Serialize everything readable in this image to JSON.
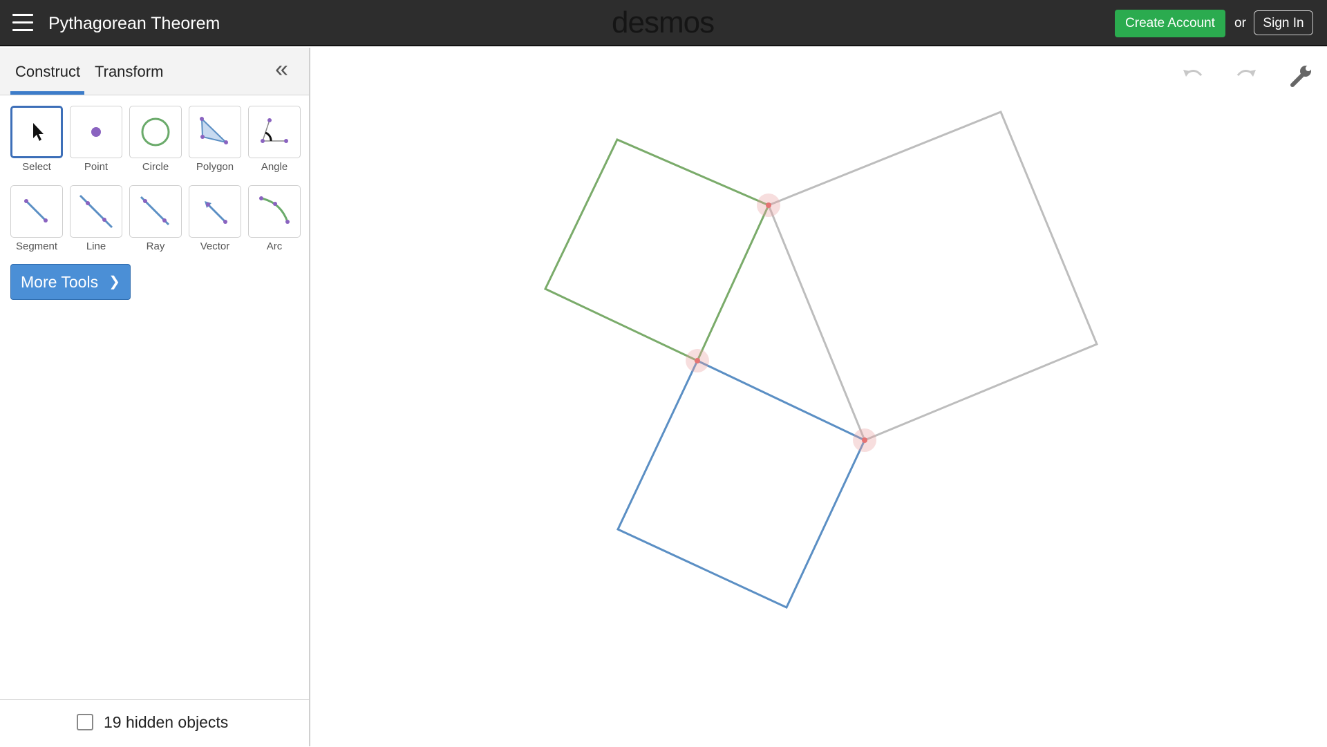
{
  "header": {
    "title": "Pythagorean Theorem",
    "brand": "desmos",
    "create_account": "Create Account",
    "or_text": "or",
    "sign_in": "Sign In"
  },
  "panel": {
    "tabs": [
      {
        "label": "Construct",
        "active": true
      },
      {
        "label": "Transform",
        "active": false
      }
    ],
    "tools": [
      {
        "label": "Select",
        "icon": "pointer-icon",
        "active": true
      },
      {
        "label": "Point",
        "icon": "point-icon"
      },
      {
        "label": "Circle",
        "icon": "circle-icon"
      },
      {
        "label": "Polygon",
        "icon": "polygon-icon"
      },
      {
        "label": "Angle",
        "icon": "angle-icon"
      },
      {
        "label": "Segment",
        "icon": "segment-icon"
      },
      {
        "label": "Line",
        "icon": "line-icon"
      },
      {
        "label": "Ray",
        "icon": "ray-icon"
      },
      {
        "label": "Vector",
        "icon": "vector-icon"
      },
      {
        "label": "Arc",
        "icon": "arc-icon"
      }
    ],
    "more_tools": "More Tools",
    "hidden_objects": "19 hidden objects"
  },
  "colors": {
    "square_a": "#7aab6a",
    "square_b": "#5b8fc4",
    "square_c": "#bdbdbd",
    "vertex": "#e8a0a0",
    "accent": "#3d7cc9",
    "create_btn": "#2bab4f"
  }
}
